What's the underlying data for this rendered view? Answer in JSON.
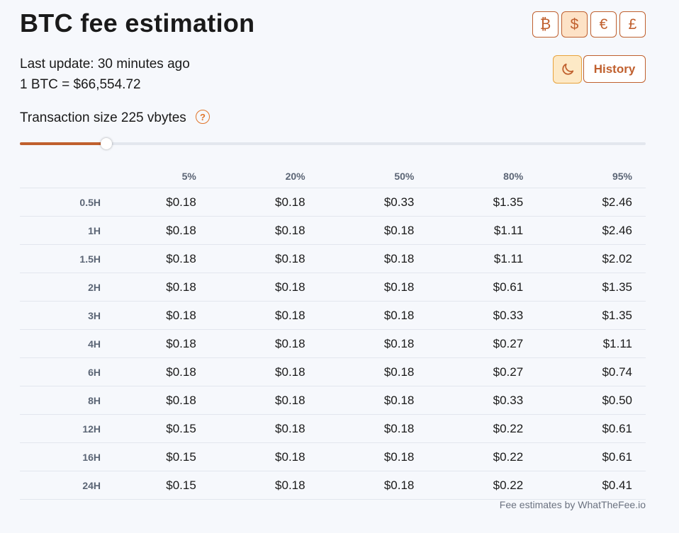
{
  "title": "BTC fee estimation",
  "currencies": [
    {
      "symbol": "₿",
      "name": "bitcoin",
      "active": false
    },
    {
      "symbol": "$",
      "name": "usd",
      "active": true
    },
    {
      "symbol": "€",
      "name": "eur",
      "active": false
    },
    {
      "symbol": "£",
      "name": "gbp",
      "active": false
    }
  ],
  "theme_button_icon": "moon-icon",
  "history_label": "History",
  "last_update": "Last update: 30 minutes ago",
  "rate": "1 BTC = $66,554.72",
  "tx_size_label": "Transaction size 225 vbytes",
  "help_symbol": "?",
  "slider": {
    "fraction": 0.138
  },
  "table": {
    "columns": [
      "5%",
      "20%",
      "50%",
      "80%",
      "95%"
    ],
    "rows": [
      {
        "label": "0.5H",
        "values": [
          "$0.18",
          "$0.18",
          "$0.33",
          "$1.35",
          "$2.46"
        ]
      },
      {
        "label": "1H",
        "values": [
          "$0.18",
          "$0.18",
          "$0.18",
          "$1.11",
          "$2.46"
        ]
      },
      {
        "label": "1.5H",
        "values": [
          "$0.18",
          "$0.18",
          "$0.18",
          "$1.11",
          "$2.02"
        ]
      },
      {
        "label": "2H",
        "values": [
          "$0.18",
          "$0.18",
          "$0.18",
          "$0.61",
          "$1.35"
        ]
      },
      {
        "label": "3H",
        "values": [
          "$0.18",
          "$0.18",
          "$0.18",
          "$0.33",
          "$1.35"
        ]
      },
      {
        "label": "4H",
        "values": [
          "$0.18",
          "$0.18",
          "$0.18",
          "$0.27",
          "$1.11"
        ]
      },
      {
        "label": "6H",
        "values": [
          "$0.18",
          "$0.18",
          "$0.18",
          "$0.27",
          "$0.74"
        ]
      },
      {
        "label": "8H",
        "values": [
          "$0.18",
          "$0.18",
          "$0.18",
          "$0.33",
          "$0.50"
        ]
      },
      {
        "label": "12H",
        "values": [
          "$0.15",
          "$0.18",
          "$0.18",
          "$0.22",
          "$0.61"
        ]
      },
      {
        "label": "16H",
        "values": [
          "$0.15",
          "$0.18",
          "$0.18",
          "$0.22",
          "$0.61"
        ]
      },
      {
        "label": "24H",
        "values": [
          "$0.15",
          "$0.18",
          "$0.18",
          "$0.22",
          "$0.41"
        ]
      }
    ]
  },
  "footer": "Fee estimates by WhatTheFee.io"
}
